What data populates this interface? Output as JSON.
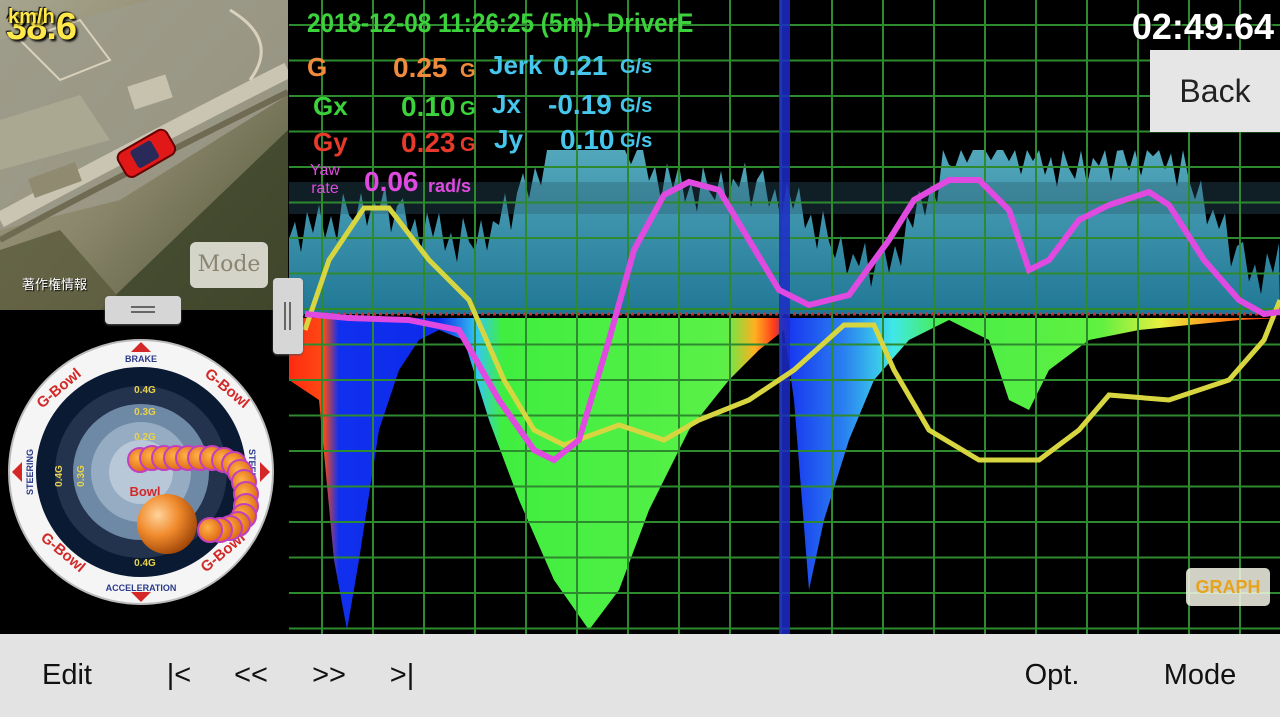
{
  "map": {
    "speed_value": "38.6",
    "speed_unit": "km/h",
    "copyright": "著作権情報",
    "mode_button": "Mode"
  },
  "session": {
    "title": "2018-12-08 11:26:25 (5m)- DriverE",
    "timer": "02:49.64"
  },
  "readouts": {
    "g": {
      "label": "G",
      "value": "0.25",
      "unit": "G",
      "color": "#f08a3c"
    },
    "gx": {
      "label": "Gx",
      "value": "0.10",
      "unit": "G",
      "color": "#3cd23c"
    },
    "gy": {
      "label": "Gy",
      "value": "0.23",
      "unit": "G",
      "color": "#e83a2a"
    },
    "yaw": {
      "label_line1": "Yaw",
      "label_line2": "rate",
      "value": "0.06",
      "unit": "rad/s",
      "color": "#e04ae0"
    },
    "jerk": {
      "label": "Jerk",
      "value": "0.21",
      "unit": "G/s",
      "color": "#46c6ec"
    },
    "jx": {
      "label": "Jx",
      "value": "-0.19",
      "unit": "G/s",
      "color": "#46c6ec"
    },
    "jy": {
      "label": "Jy",
      "value": "0.10",
      "unit": "G/s",
      "color": "#46c6ec"
    }
  },
  "bowl": {
    "brand": "G-Bowl",
    "center_brand": "Bowl",
    "top_label": "BRAKE",
    "bottom_label": "ACCELERATION",
    "left_label": "STEERING",
    "right_label": "STEERING",
    "ring_labels": [
      "0.4G",
      "0.3G",
      "0.2G"
    ],
    "side_labels": [
      "0.4G",
      "0.3G"
    ]
  },
  "buttons": {
    "back": "Back",
    "graph": "GRAPH"
  },
  "toolbar": {
    "edit": "Edit",
    "first": "|<",
    "prev": "<<",
    "next": ">>",
    "last": ">|",
    "options": "Opt.",
    "mode": "Mode"
  },
  "colors": {
    "g_line": "#f08a3c",
    "gx_line": "#d8d640",
    "gy_line": "#e83a2a",
    "yaw_line": "#e04ae0",
    "jerk_fill": "#46c6ec",
    "grid": "#2e8a2e",
    "cursor": "#1c2cc8",
    "toolbar_bg": "#e3e3e3"
  }
}
